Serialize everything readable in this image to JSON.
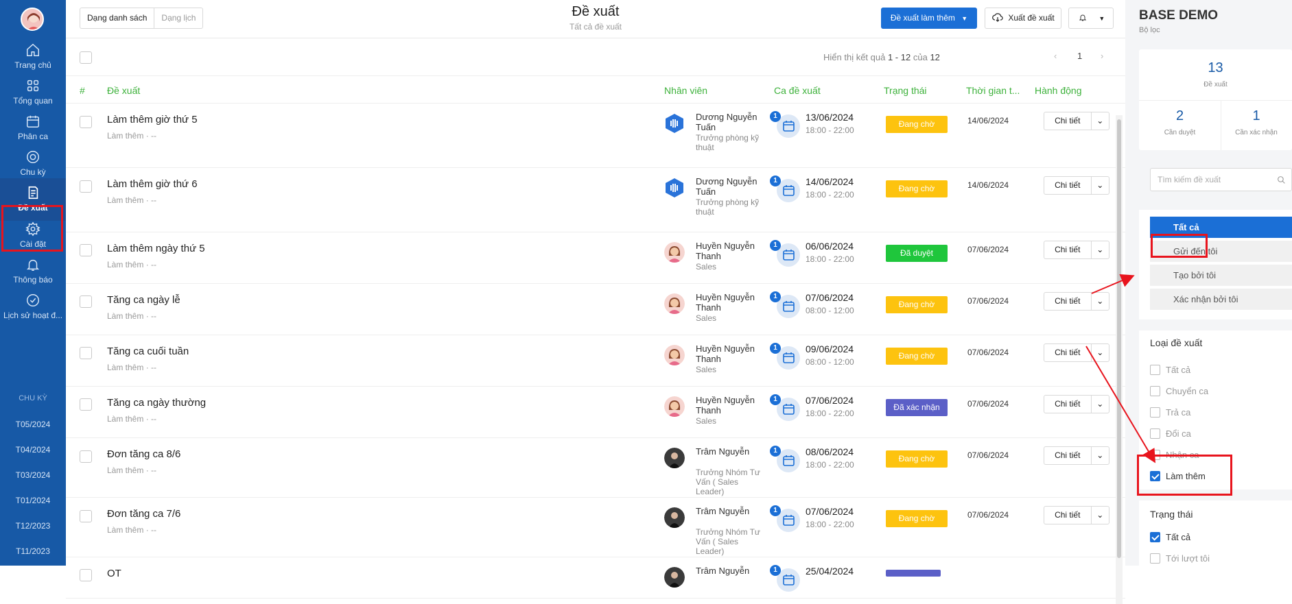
{
  "sidebar": {
    "items": [
      {
        "label": "Trang chủ",
        "icon": "home-icon"
      },
      {
        "label": "Tổng quan",
        "icon": "grid-icon"
      },
      {
        "label": "Phân ca",
        "icon": "calendar-icon"
      },
      {
        "label": "Chu kỳ",
        "icon": "cycle-icon"
      },
      {
        "label": "Đề xuất",
        "icon": "proposal-icon"
      },
      {
        "label": "Cài đặt",
        "icon": "gear-icon"
      },
      {
        "label": "Thông báo",
        "icon": "bell-icon"
      },
      {
        "label": "Lịch sử hoạt đ...",
        "icon": "check-circle-icon"
      }
    ],
    "period_heading": "CHU KỲ",
    "periods": [
      "T05/2024",
      "T04/2024",
      "T03/2024",
      "T01/2024",
      "T12/2023",
      "T11/2023"
    ]
  },
  "header": {
    "view_list": "Dạng danh sách",
    "view_calendar": "Dạng lịch",
    "title": "Đề xuất",
    "subtitle": "Tất cả đề xuất",
    "primary_button": "Đề xuất làm thêm",
    "export_button": "Xuất đề xuất"
  },
  "results": {
    "prefix": "Hiển thị kết quả",
    "range": "1 - 12",
    "of": "của",
    "total": "12",
    "page": "1"
  },
  "table": {
    "columns": [
      "#",
      "Đề xuất",
      "Nhân viên",
      "Ca đề xuất",
      "Trạng thái",
      "Thời gian t...",
      "Hành động"
    ],
    "detail_label": "Chi tiết",
    "rows": [
      {
        "title": "Làm thêm giờ thứ 5",
        "sub": "Làm thêm · --",
        "emp_name": "Dương Nguyễn Tuấn",
        "emp_role": "Trưởng phòng kỹ thuật",
        "emp_av": "logo",
        "badge": "1",
        "date": "13/06/2024",
        "time": "18:00 - 22:00",
        "status": "Đang chờ",
        "status_color": "#fdc30f",
        "created": "14/06/2024"
      },
      {
        "title": "Làm thêm giờ thứ 6",
        "sub": "Làm thêm · --",
        "emp_name": "Dương Nguyễn Tuấn",
        "emp_role": "Trưởng phòng kỹ thuật",
        "emp_av": "logo",
        "badge": "1",
        "date": "14/06/2024",
        "time": "18:00 - 22:00",
        "status": "Đang chờ",
        "status_color": "#fdc30f",
        "created": "14/06/2024"
      },
      {
        "title": "Làm thêm ngày thứ 5",
        "sub": "Làm thêm · --",
        "emp_name": "Huyền Nguyễn Thanh",
        "emp_role": "Sales",
        "emp_av": "woman",
        "badge": "1",
        "date": "06/06/2024",
        "time": "18:00 - 22:00",
        "status": "Đã duyệt",
        "status_color": "#1fc63c",
        "created": "07/06/2024"
      },
      {
        "title": "Tăng ca ngày lễ",
        "sub": "Làm thêm · --",
        "emp_name": "Huyền Nguyễn Thanh",
        "emp_role": "Sales",
        "emp_av": "woman",
        "badge": "1",
        "date": "07/06/2024",
        "time": "08:00 - 12:00",
        "status": "Đang chờ",
        "status_color": "#fdc30f",
        "created": "07/06/2024"
      },
      {
        "title": "Tăng ca cuối tuần",
        "sub": "Làm thêm · --",
        "emp_name": "Huyền Nguyễn Thanh",
        "emp_role": "Sales",
        "emp_av": "woman",
        "badge": "1",
        "date": "09/06/2024",
        "time": "08:00 - 12:00",
        "status": "Đang chờ",
        "status_color": "#fdc30f",
        "created": "07/06/2024"
      },
      {
        "title": "Tăng ca ngày thường",
        "sub": "Làm thêm · --",
        "emp_name": "Huyền Nguyễn Thanh",
        "emp_role": "Sales",
        "emp_av": "woman",
        "badge": "1",
        "date": "07/06/2024",
        "time": "18:00 - 22:00",
        "status": "Đã xác nhận",
        "status_color": "#5b5fc7",
        "created": "07/06/2024"
      },
      {
        "title": "Đơn tăng ca 8/6",
        "sub": "Làm thêm · --",
        "emp_name": "Trâm Nguyễn",
        "emp_role": "Trưởng Nhóm Tư Vấn ( Sales Leader)",
        "emp_av": "dark",
        "badge": "1",
        "date": "08/06/2024",
        "time": "18:00 - 22:00",
        "status": "Đang chờ",
        "status_color": "#fdc30f",
        "created": "07/06/2024"
      },
      {
        "title": "Đơn tăng ca 7/6",
        "sub": "Làm thêm · --",
        "emp_name": "Trâm Nguyễn",
        "emp_role": "Trưởng Nhóm Tư Vấn ( Sales Leader)",
        "emp_av": "dark",
        "badge": "1",
        "date": "07/06/2024",
        "time": "18:00 - 22:00",
        "status": "Đang chờ",
        "status_color": "#fdc30f",
        "created": "07/06/2024"
      },
      {
        "title": "OT",
        "sub": "",
        "emp_name": "Trâm Nguyễn",
        "emp_role": "",
        "emp_av": "dark",
        "badge": "1",
        "date": "25/04/2024",
        "time": "",
        "status": "",
        "status_color": "#5b5fc7",
        "created": ""
      }
    ]
  },
  "right_panel": {
    "title": "BASE DEMO",
    "subtitle": "Bộ lọc",
    "total": "13",
    "total_label": "Đề xuất",
    "need_approve": "2",
    "need_approve_label": "Cần duyệt",
    "need_confirm": "1",
    "need_confirm_label": "Cần xác nhận",
    "search_placeholder": "Tìm kiếm đề xuất",
    "filters": [
      "Tất cả",
      "Gửi đến tôi",
      "Tạo bởi tôi",
      "Xác nhận bởi tôi"
    ],
    "type_title": "Loại đề xuất",
    "types": [
      {
        "label": "Tất cả",
        "checked": false
      },
      {
        "label": "Chuyển ca",
        "checked": false
      },
      {
        "label": "Trả ca",
        "checked": false
      },
      {
        "label": "Đổi ca",
        "checked": false
      },
      {
        "label": "Nhận ca",
        "checked": false
      },
      {
        "label": "Làm thêm",
        "checked": true
      }
    ],
    "status_title": "Trạng thái",
    "statuses": [
      {
        "label": "Tất cả",
        "checked": true
      },
      {
        "label": "Tới lượt tôi",
        "checked": false
      }
    ]
  }
}
